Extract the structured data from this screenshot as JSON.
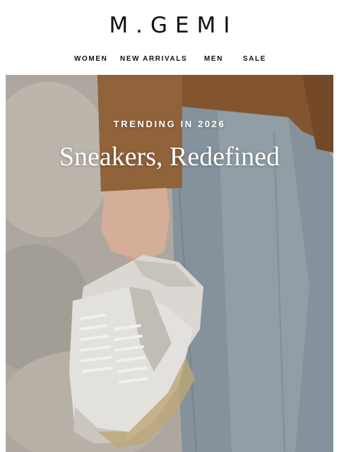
{
  "brand": {
    "logo_text": "M.GEMI"
  },
  "nav": {
    "items": [
      {
        "label": "WOMEN"
      },
      {
        "label": "NEW ARRIVALS"
      },
      {
        "label": "MEN"
      },
      {
        "label": "SALE"
      }
    ]
  },
  "hero": {
    "eyebrow": "TRENDING IN 2026",
    "headline": "Sneakers, Redefined",
    "image": "hand holding white and grey suede sneakers against jeans and stone wall"
  },
  "colors": {
    "text_dark": "#111111",
    "hero_text": "#ffffff",
    "jacket_brown": "#8a5a32",
    "denim": "#8797a3"
  }
}
